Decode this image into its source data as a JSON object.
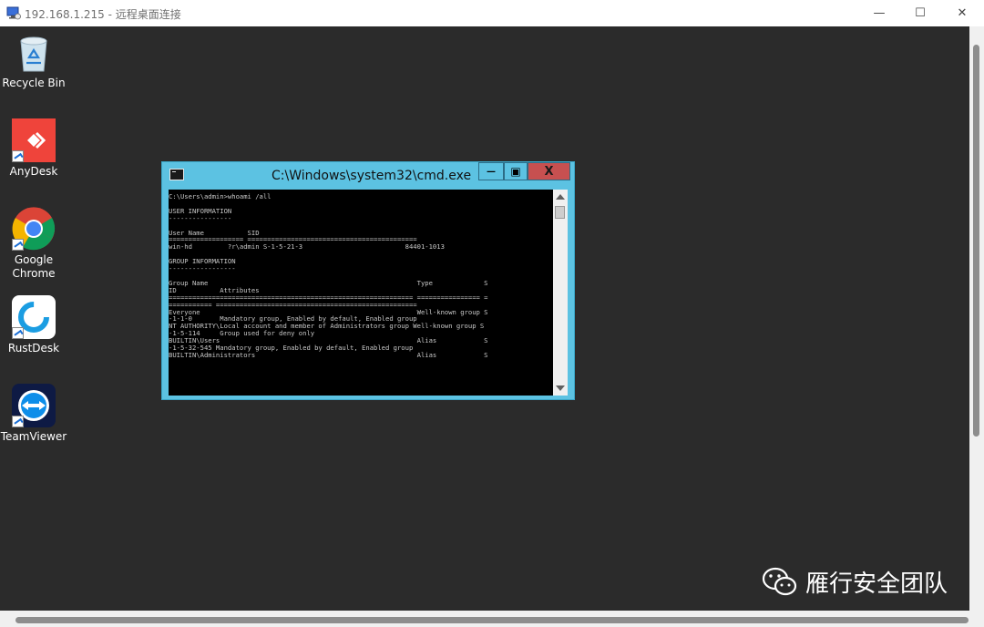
{
  "window": {
    "title": "192.168.1.215 - 远程桌面连接",
    "minimize_glyph": "—",
    "maximize_glyph": "☐",
    "close_glyph": "✕"
  },
  "desktop_icons": [
    {
      "label": "Recycle Bin",
      "icon": "recycle-bin-icon"
    },
    {
      "label": "AnyDesk",
      "icon": "anydesk-icon",
      "color": "#ef443b"
    },
    {
      "label": "Google Chrome",
      "icon": "chrome-icon"
    },
    {
      "label": "RustDesk",
      "icon": "rustdesk-icon",
      "color": "#1b9de2"
    },
    {
      "label": "TeamViewer",
      "icon": "teamviewer-icon",
      "color": "#0e8ee9"
    }
  ],
  "cmd": {
    "title": "C:\\Windows\\system32\\cmd.exe",
    "min_glyph": "—",
    "max_glyph": "▣",
    "close_glyph": "X",
    "console_text": "C:\\Users\\admin>whoami /all\n\nUSER INFORMATION\n----------------\n\nUser Name           SID\n=================== ===========================================\nwin-hd         ?r\\admin S-1-5-21-3                          84401-1013\n\nGROUP INFORMATION\n-----------------\n\nGroup Name                                                     Type             S\nID           Attributes\n============================================================== ================ =\n=========== ===================================================\nEveryone                                                       Well-known group S\n-1-1-0       Mandatory group, Enabled by default, Enabled group\nNT AUTHORITY\\Local account and member of Administrators group Well-known group S\n-1-5-114     Group used for deny only\nBUILTIN\\Users                                                  Alias            S\n-1-5-32-545 Mandatory group, Enabled by default, Enabled group\nBUILTIN\\Administrators                                         Alias            S"
  },
  "watermark": {
    "text": "雁行安全团队",
    "icon": "wechat-icon"
  }
}
